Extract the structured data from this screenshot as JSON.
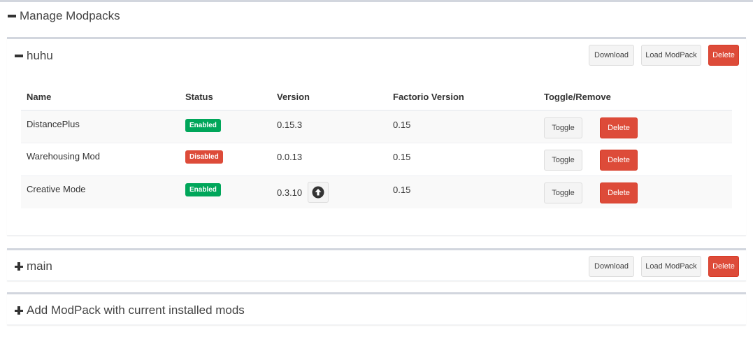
{
  "panel": {
    "title": "Manage Modpacks"
  },
  "modpacks": [
    {
      "name": "huhu",
      "expanded": true,
      "download_label": "Download",
      "load_label": "Load ModPack",
      "delete_label": "Delete",
      "columns": [
        "Name",
        "Status",
        "Version",
        "Factorio Version",
        "Toggle/Remove"
      ],
      "mods": [
        {
          "name": "DistancePlus",
          "status": "Enabled",
          "version": "0.15.3",
          "factorio_version": "0.15",
          "toggle": "Toggle",
          "delete": "Delete"
        },
        {
          "name": "Warehousing Mod",
          "status": "Disabled",
          "version": "0.0.13",
          "factorio_version": "0.15",
          "toggle": "Toggle",
          "delete": "Delete"
        },
        {
          "name": "Creative Mode",
          "status": "Enabled",
          "version": "0.3.10",
          "factorio_version": "0.15",
          "toggle": "Toggle",
          "delete": "Delete",
          "has_update": true,
          "update_icon": "arrow-circle-up-icon"
        }
      ]
    },
    {
      "name": "main",
      "expanded": false,
      "download_label": "Download",
      "load_label": "Load ModPack",
      "delete_label": "Delete"
    }
  ],
  "add_modpack": {
    "label": "Add ModPack with current installed mods"
  },
  "colors": {
    "success": "#00a65a",
    "danger": "#dd4b39",
    "box_border": "#d2d6de"
  }
}
